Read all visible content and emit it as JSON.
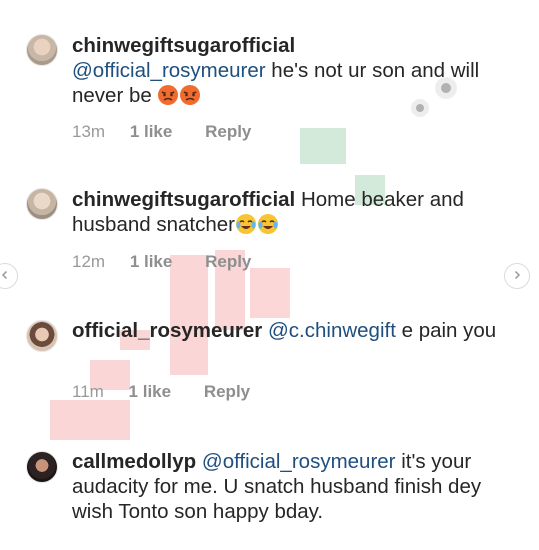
{
  "comments": [
    {
      "username": "chinwegiftsugarofficial",
      "mention": "@official_rosymeurer",
      "text": " he's not ur son and will never be",
      "emoji": [
        "angry-face",
        "angry-face"
      ],
      "time": "13m",
      "likes": "1 like",
      "reply": "Reply"
    },
    {
      "username": "chinwegiftsugarofficial",
      "mention": "",
      "text": " Home beaker and husband snatcher",
      "emoji": [
        "tears-of-joy-face",
        "tears-of-joy-face"
      ],
      "time": "12m",
      "likes": "1 like",
      "reply": "Reply"
    },
    {
      "username": "official_rosymeurer",
      "mention": "@c.chinwegift",
      "text": " e pain you",
      "emoji": [],
      "time": "11m",
      "likes": "1 like",
      "reply": "Reply"
    },
    {
      "username": "callmedollyp",
      "mention": "@official_rosymeurer",
      "text": " it's your audacity for me. U snatch husband finish dey wish Tonto son happy bday.",
      "emoji": [],
      "time": "",
      "likes": "",
      "reply": ""
    }
  ],
  "nav": {
    "left_icon": "chevron-left-icon",
    "right_icon": "chevron-right-icon"
  },
  "colors": {
    "mention": "#1f4f7f",
    "meta": "#999999",
    "text": "#262626",
    "watermark": "#f04a4a"
  }
}
